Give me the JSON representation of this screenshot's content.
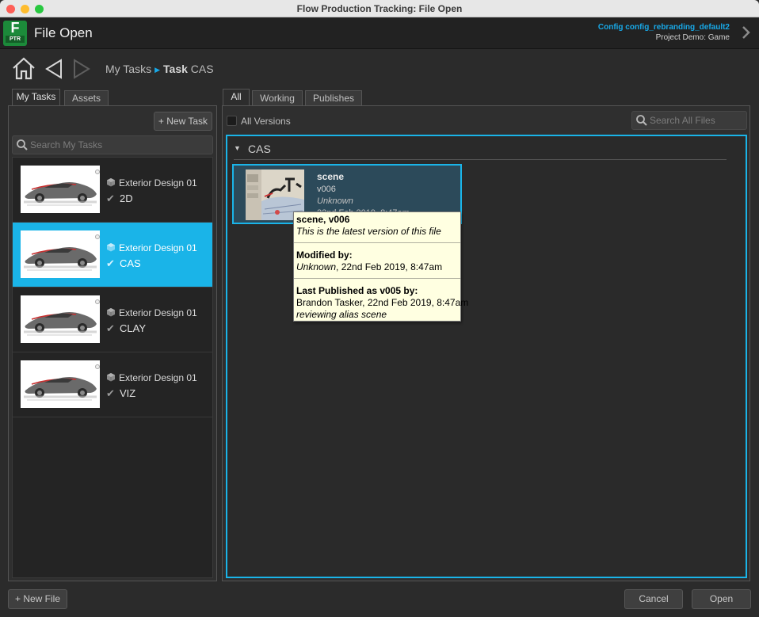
{
  "window": {
    "title": "Flow Production Tracking: File Open"
  },
  "header": {
    "logo_letter": "F",
    "logo_sub": "PTR",
    "title": "File Open",
    "config": "Config config_rebranding_default2",
    "project": "Project Demo: Game"
  },
  "breadcrumb": {
    "root": "My Tasks",
    "current_bold": "Task",
    "current_name": "CAS"
  },
  "left": {
    "tabs": [
      "My Tasks",
      "Assets"
    ],
    "new_task_label": "+ New Task",
    "search_placeholder": "Search My Tasks",
    "tasks": [
      {
        "entity": "Exterior Design 01",
        "task": "2D",
        "selected": false
      },
      {
        "entity": "Exterior Design 01",
        "task": "CAS",
        "selected": true
      },
      {
        "entity": "Exterior Design 01",
        "task": "CLAY",
        "selected": false
      },
      {
        "entity": "Exterior Design 01",
        "task": "VIZ",
        "selected": false
      }
    ]
  },
  "right": {
    "tabs": [
      "All",
      "Working",
      "Publishes"
    ],
    "all_versions_label": "All Versions",
    "search_placeholder": "Search All Files",
    "group": "CAS",
    "file": {
      "name": "scene",
      "version": "v006",
      "user": "Unknown",
      "date": "22nd Feb 2019, 8:47am"
    }
  },
  "tooltip": {
    "title": "scene, v006",
    "subtitle": "This is the latest version of this file",
    "modified_label": "Modified by:",
    "modified_user": "Unknown",
    "modified_date": ", 22nd Feb 2019, 8:47am",
    "published_label": "Last Published as v005 by:",
    "published_by": "Brandon Tasker, 22nd Feb 2019, 8:47am",
    "published_comment": "reviewing alias scene"
  },
  "footer": {
    "new_file_label": "+ New File",
    "cancel_label": "Cancel",
    "open_label": "Open"
  },
  "colors": {
    "accent": "#1ab4e8",
    "selection": "#1ab4e8",
    "logo_green": "#1c8a3a",
    "tooltip_bg": "#ffffe1"
  },
  "icons": [
    "home-icon",
    "back-arrow-icon",
    "forward-arrow-icon",
    "search-icon",
    "cube-icon",
    "checkmark-icon",
    "chevron-right-icon",
    "triangle-down-icon"
  ]
}
